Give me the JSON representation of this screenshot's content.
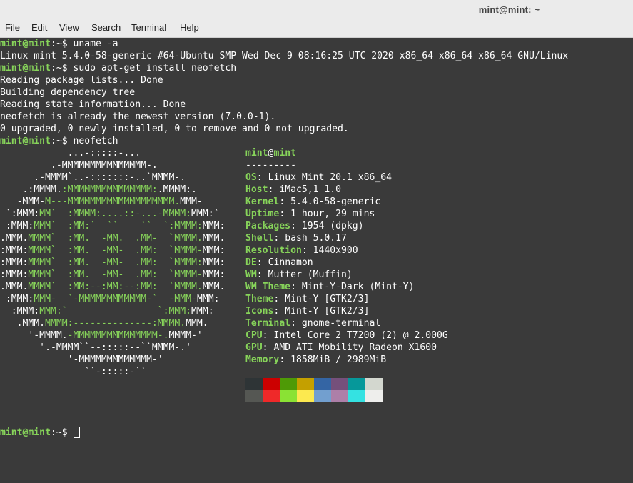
{
  "window": {
    "title": "mint@mint: ~"
  },
  "menu": [
    "File",
    "Edit",
    "View",
    "Search",
    "Terminal",
    "Help"
  ],
  "prompt": {
    "user": "mint@mint",
    "sep": ":~$ "
  },
  "session": {
    "cmd1": "uname -a",
    "out1": "Linux mint 5.4.0-58-generic #64-Ubuntu SMP Wed Dec 9 08:16:25 UTC 2020 x86_64 x86_64 x86_64 GNU/Linux",
    "cmd2": "sudo apt-get install neofetch",
    "out2": [
      "Reading package lists... Done",
      "Building dependency tree",
      "Reading state information... Done",
      "neofetch is already the newest version (7.0.0-1).",
      "0 upgraded, 0 newly installed, 0 to remove and 0 not upgraded."
    ],
    "cmd3": "neofetch"
  },
  "logo_lines": [
    [
      {
        "t": "            ...-:::::-...",
        "c": "w"
      }
    ],
    [
      {
        "t": "         .-MMMMMMMMMMMMMMM-.",
        "c": "w"
      }
    ],
    [
      {
        "t": "      .-MMMM`..-:::::::-..`MMMM-.",
        "c": "w"
      }
    ],
    [
      {
        "t": "    .:MMMM.",
        "c": "w"
      },
      {
        "t": ":MMMMMMMMMMMMMMM:",
        "c": "g"
      },
      {
        "t": ".MMMM:.",
        "c": "w"
      }
    ],
    [
      {
        "t": "   -MMM-",
        "c": "w"
      },
      {
        "t": "M---MMMMMMMMMMMMMMMMMMM.",
        "c": "g"
      },
      {
        "t": "MMM-",
        "c": "w"
      }
    ],
    [
      {
        "t": " `:MMM:",
        "c": "w"
      },
      {
        "t": "MM`  :MMMM:....::-...-MMMM:",
        "c": "g"
      },
      {
        "t": "MMM:`",
        "c": "w"
      }
    ],
    [
      {
        "t": " :MMM:",
        "c": "w"
      },
      {
        "t": "MMM`  :MM:`  ``    ``  `:MMMM:",
        "c": "g"
      },
      {
        "t": "MMM:",
        "c": "w"
      }
    ],
    [
      {
        "t": ".MMM.",
        "c": "w"
      },
      {
        "t": "MMMM`  :MM.  -MM.  .MM-  `MMMM.",
        "c": "g"
      },
      {
        "t": "MMM.",
        "c": "w"
      }
    ],
    [
      {
        "t": ":MMM:",
        "c": "w"
      },
      {
        "t": "MMMM`  :MM.  -MM-  .MM:  `MMMM-",
        "c": "g"
      },
      {
        "t": "MMM:",
        "c": "w"
      }
    ],
    [
      {
        "t": ":MMM:",
        "c": "w"
      },
      {
        "t": "MMMM`  :MM.  -MM-  .MM:  `MMMM:",
        "c": "g"
      },
      {
        "t": "MMM:",
        "c": "w"
      }
    ],
    [
      {
        "t": ":MMM:",
        "c": "w"
      },
      {
        "t": "MMMM`  :MM.  -MM-  .MM:  `MMMM-",
        "c": "g"
      },
      {
        "t": "MMM:",
        "c": "w"
      }
    ],
    [
      {
        "t": ".MMM.",
        "c": "w"
      },
      {
        "t": "MMMM`  :MM:--:MM:--:MM:  `MMMM.",
        "c": "g"
      },
      {
        "t": "MMM.",
        "c": "w"
      }
    ],
    [
      {
        "t": " :MMM:",
        "c": "w"
      },
      {
        "t": "MMM-  `-MMMMMMMMMMMM-`  -MMM-",
        "c": "g"
      },
      {
        "t": "MMM:",
        "c": "w"
      }
    ],
    [
      {
        "t": "  :MMM:",
        "c": "w"
      },
      {
        "t": "MMM:`                `:MMM:",
        "c": "g"
      },
      {
        "t": "MMM:",
        "c": "w"
      }
    ],
    [
      {
        "t": "   .MMM.",
        "c": "w"
      },
      {
        "t": "MMMM:--------------:MMMM.",
        "c": "g"
      },
      {
        "t": "MMM.",
        "c": "w"
      }
    ],
    [
      {
        "t": "     '-MMMM.",
        "c": "w"
      },
      {
        "t": "-MMMMMMMMMMMMMMM-.",
        "c": "g"
      },
      {
        "t": "MMMM-'",
        "c": "w"
      }
    ],
    [
      {
        "t": "       '.-MMMM``--:::::--``MMMM-.'",
        "c": "w"
      }
    ],
    [
      {
        "t": "            '-MMMMMMMMMMMMM-'",
        "c": "w"
      }
    ],
    [
      {
        "t": "               ``-:::::-``",
        "c": "w"
      }
    ]
  ],
  "info": {
    "header_user": "mint",
    "header_at": "@",
    "header_host": "mint",
    "separator": "---------",
    "rows": [
      {
        "label": "OS",
        "value": "Linux Mint 20.1 x86_64"
      },
      {
        "label": "Host",
        "value": "iMac5,1 1.0"
      },
      {
        "label": "Kernel",
        "value": "5.4.0-58-generic"
      },
      {
        "label": "Uptime",
        "value": "1 hour, 29 mins"
      },
      {
        "label": "Packages",
        "value": "1954 (dpkg)"
      },
      {
        "label": "Shell",
        "value": "bash 5.0.17"
      },
      {
        "label": "Resolution",
        "value": "1440x900"
      },
      {
        "label": "DE",
        "value": "Cinnamon"
      },
      {
        "label": "WM",
        "value": "Mutter (Muffin)"
      },
      {
        "label": "WM Theme",
        "value": "Mint-Y-Dark (Mint-Y)"
      },
      {
        "label": "Theme",
        "value": "Mint-Y [GTK2/3]"
      },
      {
        "label": "Icons",
        "value": "Mint-Y [GTK2/3]"
      },
      {
        "label": "Terminal",
        "value": "gnome-terminal"
      },
      {
        "label": "CPU",
        "value": "Intel Core 2 T7200 (2) @ 2.000G"
      },
      {
        "label": "GPU",
        "value": "AMD ATI Mobility Radeon X1600"
      },
      {
        "label": "Memory",
        "value": "1858MiB / 2989MiB"
      }
    ]
  },
  "palette": {
    "normal": [
      "#2e3436",
      "#cc0000",
      "#4e9a06",
      "#c4a000",
      "#3465a4",
      "#75507b",
      "#06989a",
      "#d3d7cf"
    ],
    "bright": [
      "#555753",
      "#ef2929",
      "#8ae234",
      "#fce94f",
      "#729fcf",
      "#ad7fa8",
      "#34e2e2",
      "#eeeeec"
    ]
  },
  "colors": {
    "prompt_green": "#87d45a",
    "background": "#3a3a3a",
    "titlebar": "#ebebeb"
  }
}
